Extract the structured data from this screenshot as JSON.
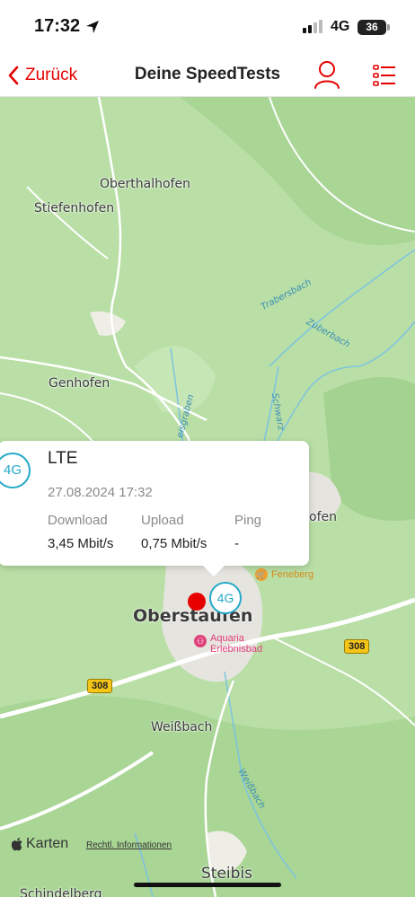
{
  "status_bar": {
    "time": "17:32",
    "network": "4G",
    "battery": "36"
  },
  "header": {
    "back_label": "Zurück",
    "title": "Deine SpeedTests"
  },
  "map": {
    "places": {
      "oberthalhofen": "Oberthalhofen",
      "stiefenhofen": "Stiefenhofen",
      "genhofen": "Genhofen",
      "hofen": "ofen",
      "oberstaufen": "Oberstaufen",
      "weissbach_town": "Weißbach",
      "steibis": "Steibis",
      "schindelberg": "Schindelberg"
    },
    "waters": {
      "trabersbach": "Trabersbach",
      "zuberbach": "Zuberbach",
      "schwarz": "Schwarz",
      "eisgraben": "eisgraben",
      "weissbach_river": "Weißbach"
    },
    "roads": {
      "r308_right": "308",
      "r308_left": "308"
    },
    "pois": {
      "feneberg": "Feneberg",
      "aquaria": "Aquaria",
      "erlebnisbad": "Erlebnisbad"
    },
    "marker_label": "4G"
  },
  "card": {
    "badge": "4G",
    "type": "LTE",
    "datetime": "27.08.2024 17:32",
    "download_label": "Download",
    "download_value": "3,45 Mbit/s",
    "upload_label": "Upload",
    "upload_value": "0,75 Mbit/s",
    "ping_label": "Ping",
    "ping_value": "-"
  },
  "footer": {
    "maps_brand": "Karten",
    "legal": "Rechtl. Informationen"
  },
  "colors": {
    "accent": "#e60000",
    "network_badge": "#23a9c9",
    "map_green": "#b9dfa6"
  }
}
